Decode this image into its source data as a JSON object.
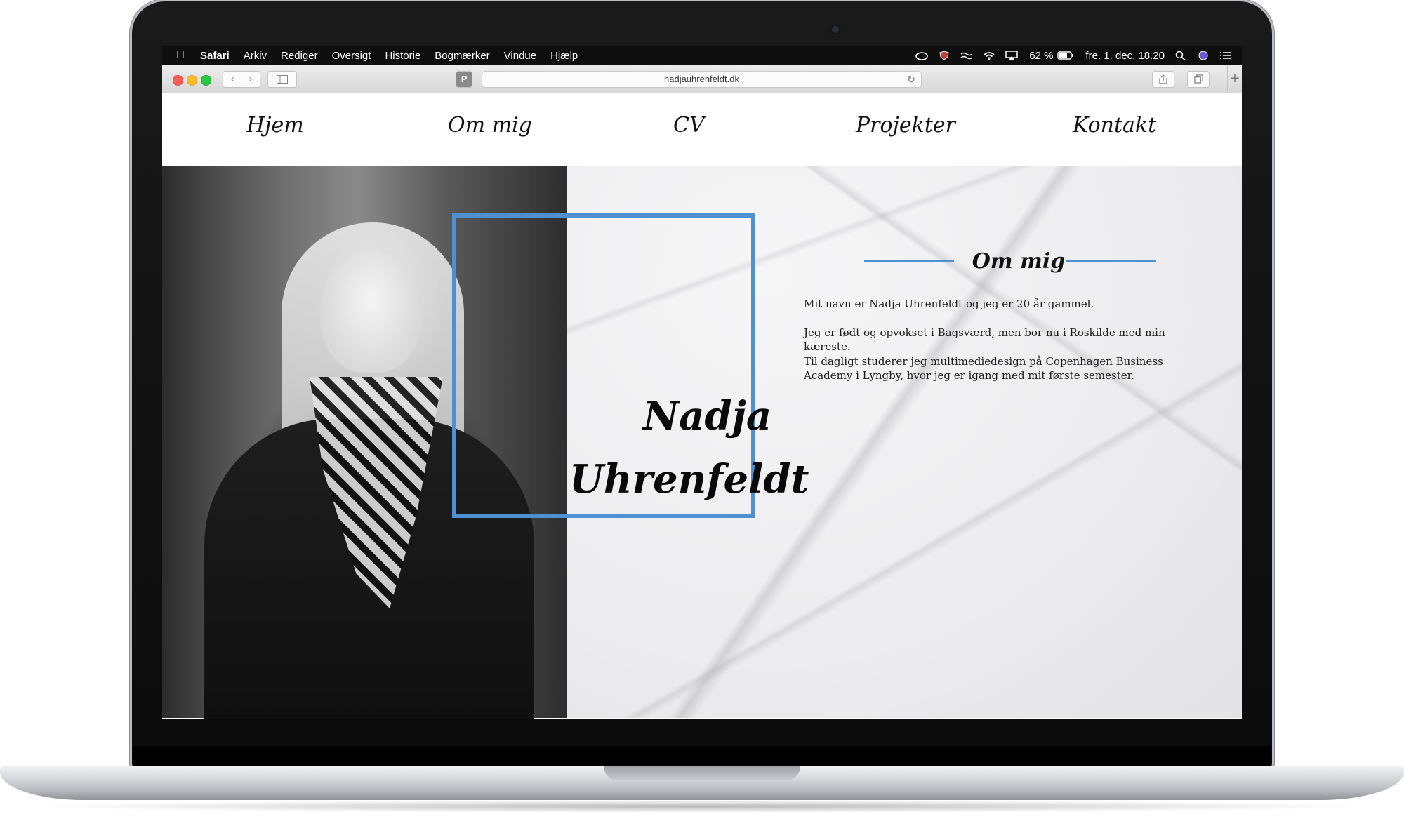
{
  "menubar": {
    "app": "Safari",
    "items": [
      "Arkiv",
      "Rediger",
      "Oversigt",
      "Historie",
      "Bogmærker",
      "Vindue",
      "Hjælp"
    ],
    "battery": "62 %",
    "datetime": "fre. 1. dec. 18.20"
  },
  "browser": {
    "url": "nadjauhrenfeldt.dk",
    "reader_label": "P",
    "new_tab": "+"
  },
  "nav": {
    "items": [
      "Hjem",
      "Om mig",
      "CV",
      "Projekter",
      "Kontakt"
    ]
  },
  "hero": {
    "first_name": "Nadja",
    "last_name": "Uhrenfeldt"
  },
  "about": {
    "title": "Om mig",
    "paragraphs": [
      "Mit navn er Nadja Uhrenfeldt og jeg er 20 år gammel.",
      "Jeg er født og opvokset i Bagsværd, men bor nu i Roskilde med min kæreste.",
      "Til dagligt studerer jeg multimediedesign på Copenhagen Business Academy i Lyngby, hvor jeg er igang med mit første semester."
    ]
  },
  "colors": {
    "accent": "#4f8fd3",
    "menubar": "#0e0e0e"
  }
}
